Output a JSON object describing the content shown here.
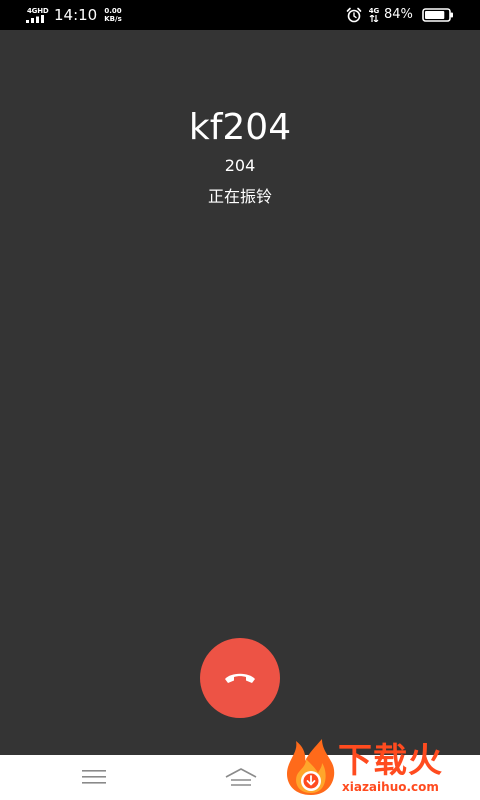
{
  "status_bar": {
    "network_label": "4GHD",
    "time": "14:10",
    "speed_value": "0.00",
    "speed_unit": "KB/s",
    "data_label": "4G",
    "battery_percent": "84%",
    "battery_level": 0.84,
    "icons": [
      "signal-icon",
      "alarm-icon",
      "battery-icon"
    ]
  },
  "call": {
    "name": "kf204",
    "number": "204",
    "status": "正在振铃"
  },
  "end_call": {
    "icon": "phone-hangup-icon",
    "color": "#ed5345"
  },
  "navigation": {
    "icons": [
      "menu-icon",
      "home-icon"
    ]
  },
  "watermark": {
    "text": "下载火",
    "url": "xiazaihuo.com"
  },
  "colors": {
    "background": "#343434",
    "status_bar": "#000000",
    "accent": "#ed5345",
    "watermark": "#ff4b1f"
  }
}
